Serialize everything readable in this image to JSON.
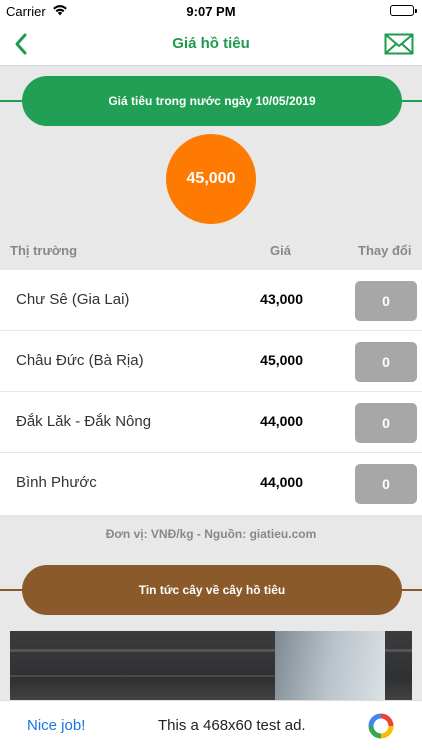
{
  "status_bar": {
    "carrier": "Carrier",
    "time": "9:07 PM"
  },
  "nav": {
    "title": "Giá hồ tiêu"
  },
  "header_banner": {
    "label": "Giá tiêu trong nước ngày 10/05/2019",
    "color": "#21a055"
  },
  "current_price": {
    "value": "45,000",
    "color": "#ff7a00"
  },
  "table": {
    "headers": {
      "market": "Thị trường",
      "price": "Giá",
      "change": "Thay đổi"
    },
    "rows": [
      {
        "market": "Chư Sê (Gia Lai)",
        "price": "43,000",
        "change": "0"
      },
      {
        "market": "Châu Đức (Bà Rịa)",
        "price": "45,000",
        "change": "0"
      },
      {
        "market": "Đắk Lăk - Đắk Nông",
        "price": "44,000",
        "change": "0"
      },
      {
        "market": "Bình Phước",
        "price": "44,000",
        "change": "0"
      }
    ]
  },
  "note": "Đơn vị: VNĐ/kg - Nguồn: giatieu.com",
  "news_banner": {
    "label": "Tin tức cây về cây hồ tiêu",
    "color": "#8a5a2b"
  },
  "ad": {
    "nice": "Nice job!",
    "text": "This a 468x60 test ad."
  }
}
